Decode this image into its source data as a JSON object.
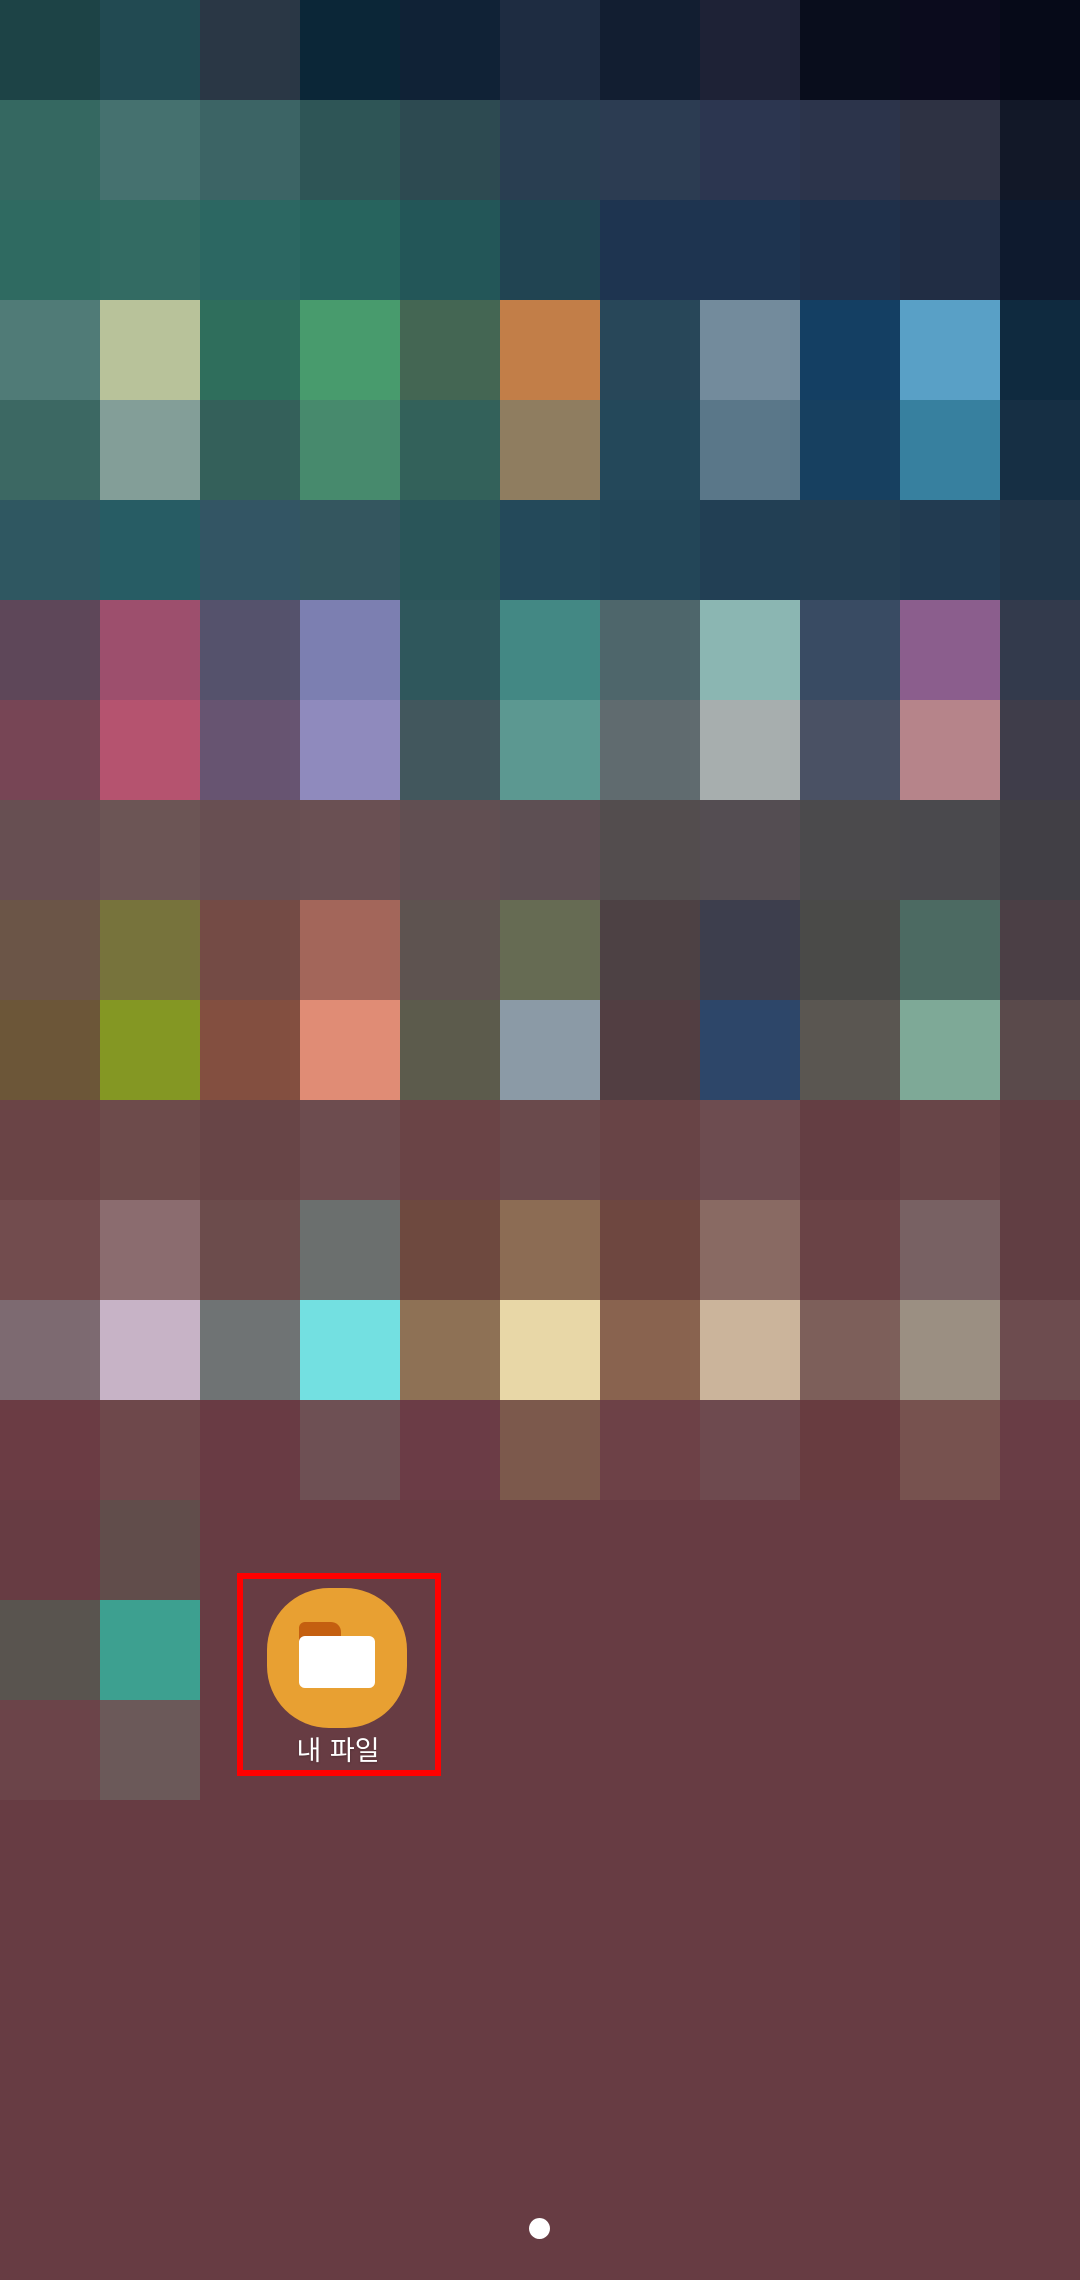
{
  "wallpaper": {
    "description_colors": [
      [
        "#1d4346",
        "#224a52",
        "#2a3745",
        "#0b2637",
        "#102236",
        "#1e2c41",
        "#121e31",
        "#1e2236",
        "#090d1c",
        "#0b0b1d",
        "#060a18"
      ],
      [
        "#356861",
        "#45716f",
        "#3c6465",
        "#2e5556",
        "#2d4a51",
        "#293e51",
        "#2c3c52",
        "#2c3650",
        "#2c344b",
        "#2e3243",
        "#121828"
      ],
      [
        "#2f6a61",
        "#336b63",
        "#2c6762",
        "#27645e",
        "#235658",
        "#214452",
        "#1e3450",
        "#1e3450",
        "#1f304a",
        "#212d44",
        "#0e1a2e"
      ],
      [
        "#507b77",
        "#b8c29a",
        "#2f6e5c",
        "#489b6d",
        "#446653",
        "#c27e48",
        "#284759",
        "#738b9c",
        "#143f63",
        "#59a0c6",
        "#0f2a3f"
      ],
      [
        "#3c6863",
        "#839e98",
        "#34605a",
        "#478a6d",
        "#33615a",
        "#8f7d60",
        "#24485a",
        "#5a7789",
        "#174060",
        "#37809f",
        "#162f44"
      ],
      [
        "#2f5761",
        "#275c64",
        "#335564",
        "#34565f",
        "#2a5559",
        "#24495a",
        "#234658",
        "#223f54",
        "#243e52",
        "#223b51",
        "#223649"
      ],
      [
        "#5e4759",
        "#9d4f6d",
        "#55526c",
        "#7c7fb1",
        "#2f575c",
        "#438884",
        "#4e666b",
        "#8bb6b2",
        "#394b63",
        "#8b5e8d",
        "#333a4c"
      ],
      [
        "#774555",
        "#b5536f",
        "#675471",
        "#8f8abd",
        "#42575d",
        "#5c9891",
        "#606b6f",
        "#a7aeae",
        "#4a5164",
        "#b6848a",
        "#3f3d4a"
      ],
      [
        "#674f52",
        "#6c5555",
        "#684f52",
        "#6a5053",
        "#614f52",
        "#5d4f53",
        "#534d4e",
        "#544d52",
        "#4b4a4c",
        "#4a494d",
        "#413f45"
      ],
      [
        "#6b5547",
        "#77733c",
        "#744b45",
        "#a3665a",
        "#5e5350",
        "#666b53",
        "#4d4144",
        "#3d3e4d",
        "#4a4a48",
        "#4c6a62",
        "#4b3f45"
      ],
      [
        "#6c5638",
        "#849723",
        "#834f40",
        "#e08c75",
        "#5c5b4c",
        "#8b9aa6",
        "#523e42",
        "#2d4669",
        "#5a5651",
        "#7ea997",
        "#5a4a4b"
      ],
      [
        "#6a4446",
        "#6d4b4b",
        "#684547",
        "#6d4c4f",
        "#6a4446",
        "#6a4a4c",
        "#684446",
        "#6d4c50",
        "#643e43",
        "#684548",
        "#603f43"
      ],
      [
        "#724c4e",
        "#8b6c6f",
        "#6c4c4c",
        "#6b6f6e",
        "#6e493f",
        "#8c6c54",
        "#6e4740",
        "#896a63",
        "#6a4346",
        "#786163",
        "#613e43"
      ],
      [
        "#7d6a71",
        "#c7b3c6",
        "#6f7374",
        "#73e0e1",
        "#8e7155",
        "#e8d7a7",
        "#89634f",
        "#cbb49b",
        "#7d5f5a",
        "#9b8f82",
        "#6d4c4f"
      ],
      [
        "#6b3c44",
        "#6e484b",
        "#693b44",
        "#6e5054",
        "#6b3c46",
        "#7c594c",
        "#6d4147",
        "#6e4a4f",
        "#683c40",
        "#77524f",
        "#693d45"
      ],
      [
        "#673c43",
        "#614d4b",
        "#673c43",
        "#673c43",
        "#673c43",
        "#673c43",
        "#673c43",
        "#673c43",
        "#673c43",
        "#673c43",
        "#673c43"
      ],
      [
        "#59544f",
        "#3da090",
        "#673c43",
        "#673c43",
        "#673c43",
        "#673c43",
        "#673c43",
        "#673c43",
        "#673c43",
        "#673c43",
        "#673c43"
      ],
      [
        "#6b4449",
        "#6b5959",
        "#673c43",
        "#673c43",
        "#673c43",
        "#673c43",
        "#673c43",
        "#673c43",
        "#673c43",
        "#673c43",
        "#673c43"
      ]
    ]
  },
  "apps": [
    {
      "label": "내 파일",
      "icon": "folder-icon",
      "icon_color": "#e8a032",
      "folder_tab_color": "#c45f10"
    }
  ],
  "highlight_color": "#ff0000",
  "page_indicator": {
    "current_page": 1,
    "total_pages": 1
  }
}
